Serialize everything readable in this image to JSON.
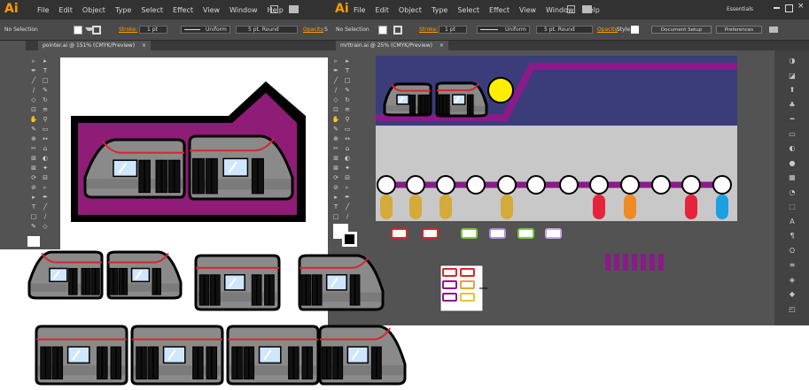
{
  "left_window": {
    "app_logo": "Ai",
    "menu": [
      "File",
      "Edit",
      "Object",
      "Type",
      "Select",
      "Effect",
      "View",
      "Window",
      "Help"
    ],
    "selection_label": "No Selection",
    "stroke_label": "Stroke:",
    "stroke_value": "1 pt",
    "stroke_style": "Uniform",
    "brush_value": "5 pt. Round",
    "opacity_label": "Opacity",
    "style_label": "Styl",
    "doc_tab": "pointer.ai @ 151% (CMYK/Preview)",
    "close_glyph": "×"
  },
  "right_window": {
    "app_logo": "Ai",
    "menu": [
      "File",
      "Edit",
      "Object",
      "Type",
      "Select",
      "Effect",
      "View",
      "Window",
      "Help"
    ],
    "workspace": "Essentials",
    "selection_label": "No Selection",
    "stroke_label": "Stroke:",
    "stroke_value": "1 pt",
    "stroke_style": "Uniform",
    "brush_value": "5 pt. Round",
    "opacity_label": "Opacity",
    "style_label": "Style:",
    "document_setup_label": "Document Setup",
    "preferences_label": "Preferences",
    "doc_tab": "mrttrain.ai @ 25% (CMYK/Preview)",
    "close_glyph": "×"
  },
  "colors": {
    "ui_dark": "#323232",
    "ui_mid": "#535353",
    "magenta": "#8f1c77",
    "navy": "#3a3d7a",
    "train_grey": "#8a8a8a",
    "stripe_red": "#d8262c",
    "window_blue": "#cfe6ff",
    "sun_yellow": "#ffee00",
    "track_grey": "#c8c8c8",
    "purple_line": "#8b1a8a",
    "logo_orange": "#ff9a00"
  },
  "route_pins": [
    "#d4aa3a",
    "#d4aa3a",
    "#d4aa3a",
    "#d4aa3a",
    "#e5243b",
    "#f08a24",
    "#e5243b",
    "#1ba0e2"
  ],
  "swatch_outlines": [
    "#d8262c",
    "#d8262c",
    "#7ac943",
    "#b48ee0",
    "#7ac943",
    "#c8a6e8"
  ],
  "icons": [
    "selection-icon",
    "direct-selection-icon",
    "pen-icon",
    "type-icon",
    "line-icon",
    "rectangle-icon",
    "brush-icon",
    "pencil-icon",
    "eraser-icon",
    "rotate-icon",
    "scale-icon",
    "warp-icon",
    "hand-icon",
    "zoom-icon",
    "fill-swatch-icon",
    "stroke-swatch-icon",
    "color-icon",
    "swatches-icon",
    "brushes-icon",
    "symbols-icon",
    "stroke-panel-icon",
    "gradient-icon",
    "transparency-icon",
    "appearance-icon",
    "graphic-styles-icon",
    "layers-icon",
    "artboards-icon",
    "character-icon",
    "paragraph-icon",
    "opentype-icon",
    "align-icon"
  ]
}
